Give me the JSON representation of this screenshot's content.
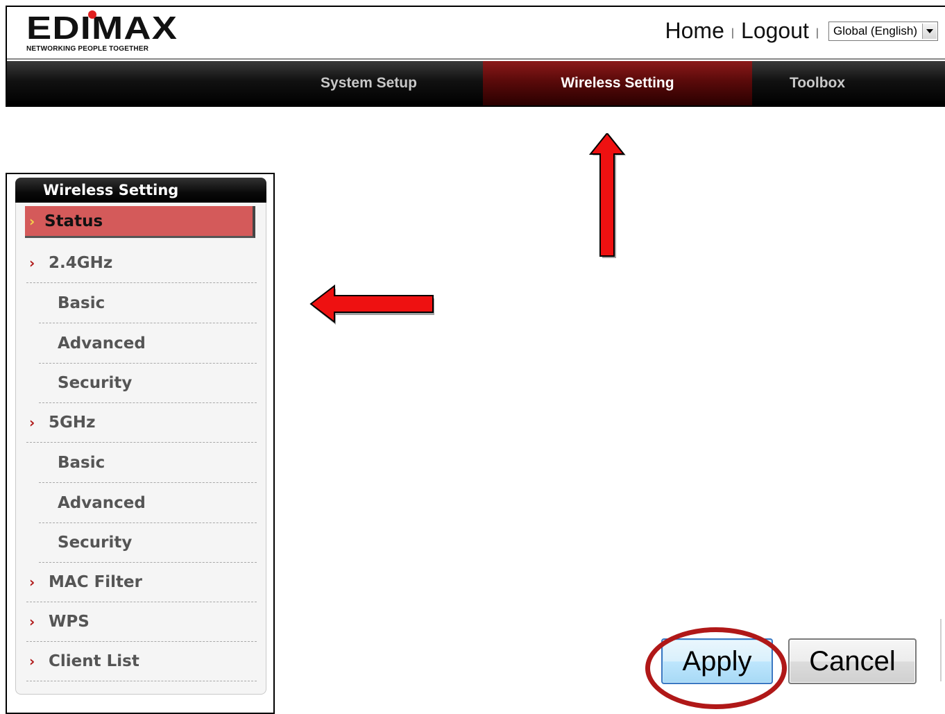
{
  "brand": {
    "logo_text": "EDIMAX",
    "tagline": "NETWORKING PEOPLE TOGETHER"
  },
  "top_links": {
    "home": "Home",
    "logout": "Logout",
    "separator": "|",
    "language": "Global (English)"
  },
  "nav": {
    "tabs": [
      {
        "label": "System Setup",
        "active": false
      },
      {
        "label": "Wireless Setting",
        "active": true
      },
      {
        "label": "Toolbox",
        "active": false
      }
    ]
  },
  "sidebar": {
    "title": "Wireless Setting",
    "status": "Status",
    "items": [
      {
        "label": "2.4GHz",
        "level": "top"
      },
      {
        "label": "Basic",
        "level": "sub"
      },
      {
        "label": "Advanced",
        "level": "sub"
      },
      {
        "label": "Security",
        "level": "sub"
      },
      {
        "label": "5GHz",
        "level": "top"
      },
      {
        "label": "Basic",
        "level": "sub"
      },
      {
        "label": "Advanced",
        "level": "sub"
      },
      {
        "label": "Security",
        "level": "sub"
      },
      {
        "label": "MAC Filter",
        "level": "top"
      },
      {
        "label": "WPS",
        "level": "top"
      },
      {
        "label": "Client List",
        "level": "top"
      }
    ]
  },
  "actions": {
    "apply": "Apply",
    "cancel": "Cancel"
  },
  "colors": {
    "accent_red": "#b01818",
    "active_tab": "#5a0a0a",
    "status_highlight": "#d45a5a"
  },
  "icons": {
    "chevron": "chevron-right-icon",
    "dropdown": "dropdown-arrow-icon",
    "annotation": "red-arrow-icon"
  }
}
